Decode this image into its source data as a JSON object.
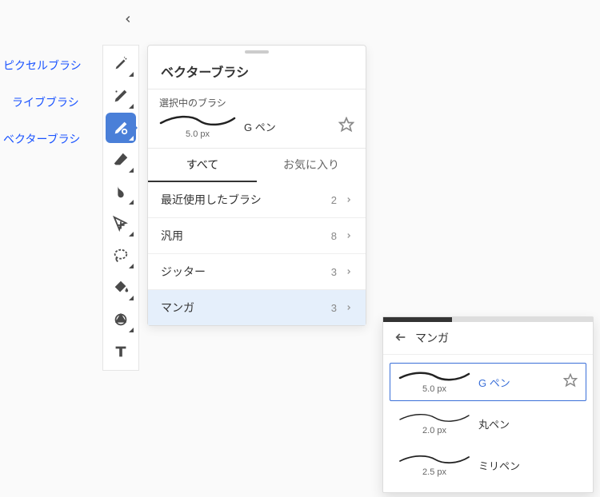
{
  "annotations": {
    "pixel_brush": "ピクセルブラシ",
    "live_brush": "ライブブラシ",
    "vector_brush": "ベクターブラシ"
  },
  "panel": {
    "title": "ベクターブラシ",
    "selected_label": "選択中のブラシ",
    "selected_brush_name": "G ペン",
    "selected_brush_size": "5.0 px",
    "tabs": {
      "all": "すべて",
      "fav": "お気に入り"
    },
    "categories": [
      {
        "label": "最近使用したブラシ",
        "count": "2"
      },
      {
        "label": "汎用",
        "count": "8"
      },
      {
        "label": "ジッター",
        "count": "3"
      },
      {
        "label": "マンガ",
        "count": "3"
      }
    ]
  },
  "subpanel": {
    "title": "マンガ",
    "brushes": [
      {
        "name": "G ペン",
        "size": "5.0 px"
      },
      {
        "name": "丸ペン",
        "size": "2.0 px"
      },
      {
        "name": "ミリペン",
        "size": "2.5 px"
      }
    ]
  }
}
